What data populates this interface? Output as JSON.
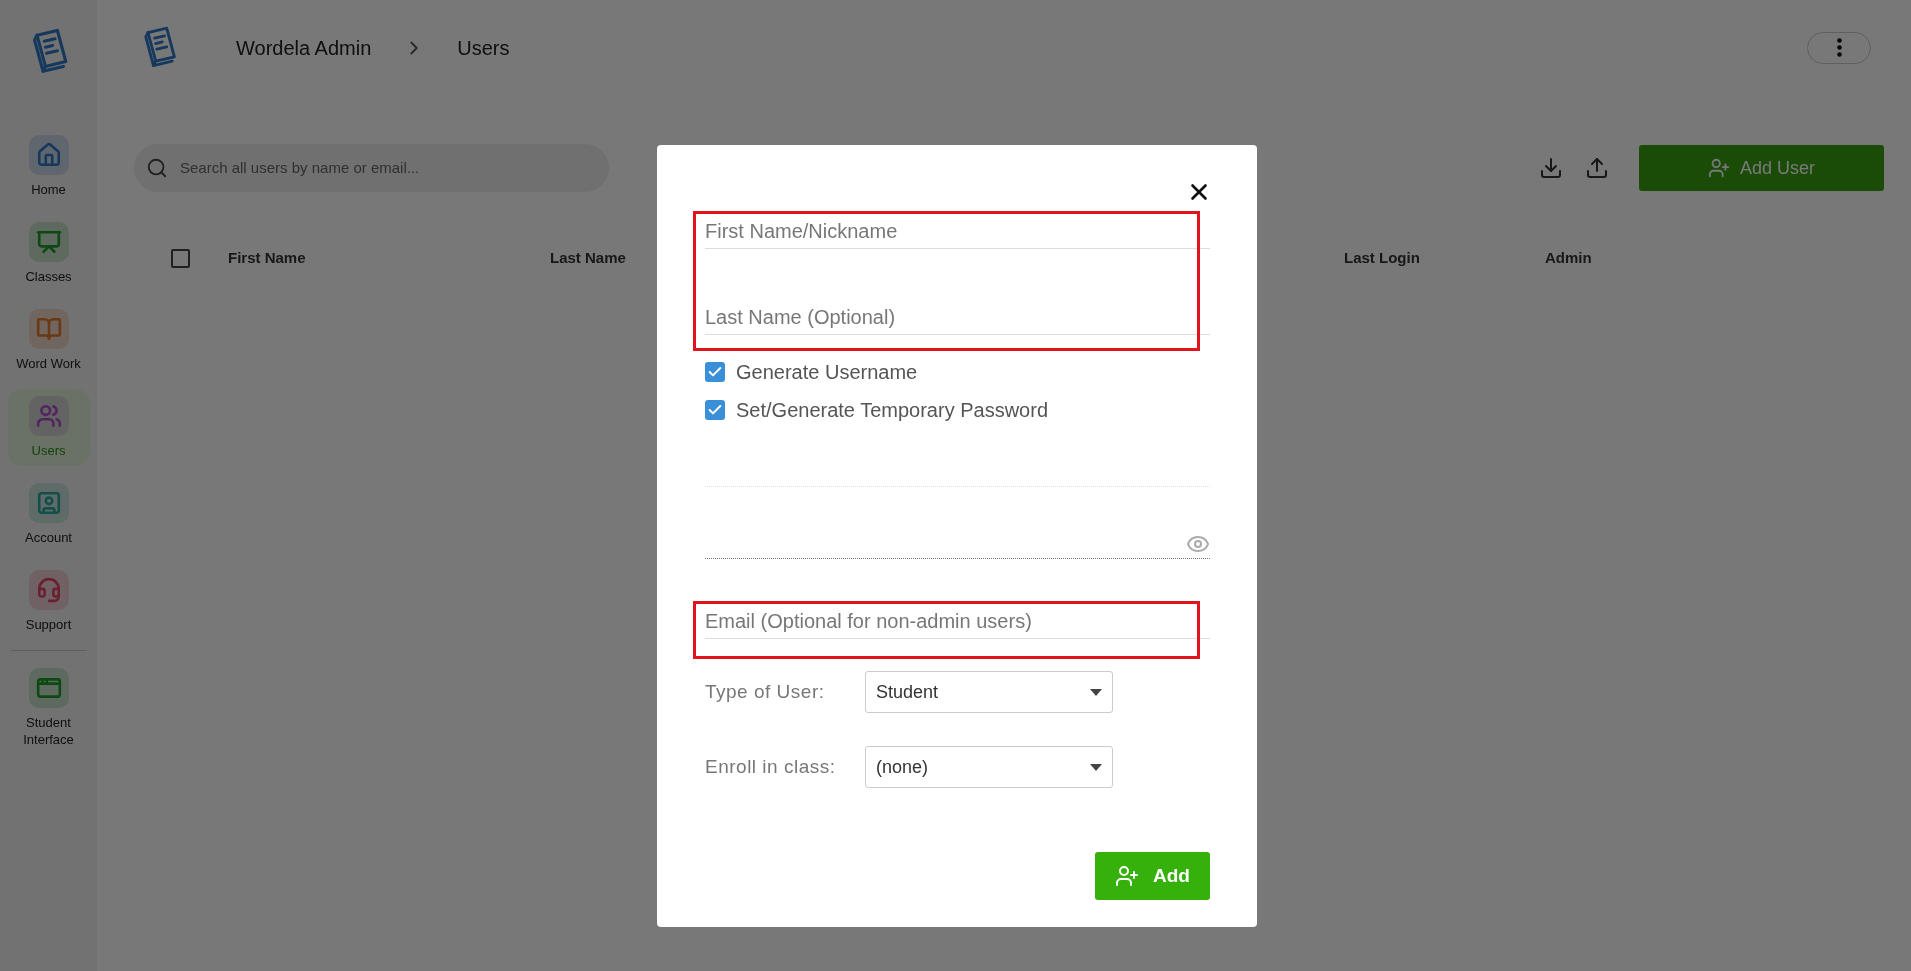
{
  "sidebar": {
    "items": [
      {
        "label": "Home",
        "selected": false
      },
      {
        "label": "Classes",
        "selected": false
      },
      {
        "label": "Word Work",
        "selected": false
      },
      {
        "label": "Users",
        "selected": true
      },
      {
        "label": "Account",
        "selected": false
      },
      {
        "label": "Support",
        "selected": false
      },
      {
        "label": "Student Interface",
        "selected": false
      }
    ]
  },
  "header": {
    "breadcrumb": [
      "Wordela Admin",
      "Users"
    ]
  },
  "toolbar": {
    "search": {
      "placeholder": "Search all users by name or email..."
    },
    "add_button": "Add User"
  },
  "table": {
    "columns": [
      {
        "label": "First Name"
      },
      {
        "label": "Last Name"
      },
      {
        "label": "Last Login"
      },
      {
        "label": "Admin"
      }
    ],
    "select_all_checked": false
  },
  "dialog": {
    "name_group": {
      "highlighted": true,
      "fields": [
        {
          "placeholder": "First Name/Nickname"
        },
        {
          "placeholder": "Last Name (Optional)"
        }
      ]
    },
    "options": [
      {
        "label": "Generate Username",
        "checked": true
      },
      {
        "label": "Set/Generate Temporary Password",
        "checked": true
      }
    ],
    "credential_fields": [
      {
        "kind": "text"
      },
      {
        "kind": "password"
      }
    ],
    "email": {
      "highlighted": true,
      "placeholder": "Email (Optional for non-admin users)"
    },
    "selects": [
      {
        "label": "Type of User:",
        "value": "Student"
      },
      {
        "label": "Enroll in class:",
        "value": "(none)"
      }
    ],
    "submit": "Add"
  }
}
